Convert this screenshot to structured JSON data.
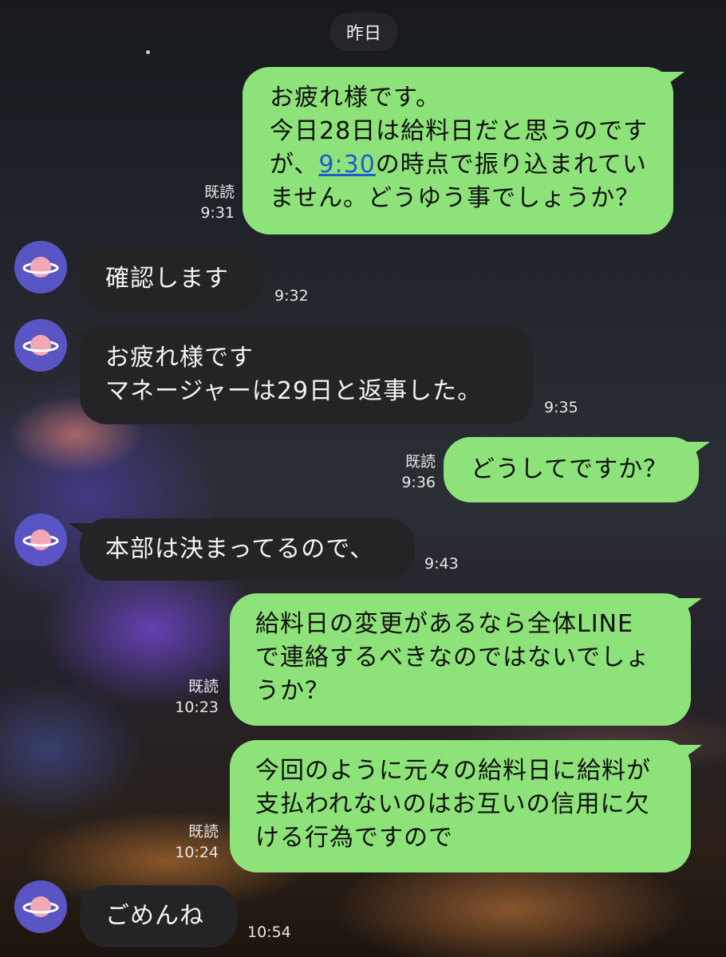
{
  "date_label": "昨日",
  "messages": [
    {
      "sender": "me",
      "lines": [
        "お疲れ様です。",
        "今日28日は給料日だと思うのです"
      ],
      "line3_prefix": "が、",
      "line3_link": "9:30",
      "line3_suffix": "の時点で振り込まれてい",
      "line4": "ません。どうゆう事でしょうか？",
      "read": "既読",
      "time": "9:31"
    },
    {
      "sender": "other",
      "text": "確認します",
      "time": "9:32"
    },
    {
      "sender": "other",
      "text": "お疲れ様です\nマネージャーは29日と返事した。",
      "time": "9:35"
    },
    {
      "sender": "me",
      "text": "どうしてですか？",
      "read": "既読",
      "time": "9:36"
    },
    {
      "sender": "other",
      "text": "本部は決まってるので、",
      "time": "9:43"
    },
    {
      "sender": "me",
      "text": "給料日の変更があるなら全体LINE\nで連絡するべきなのではないでしょ\nうか？",
      "read": "既読",
      "time": "10:23"
    },
    {
      "sender": "me",
      "text": "今回のように元々の給料日に給料が\n支払われないのはお互いの信用に欠\nける行為ですので",
      "read": "既読",
      "time": "10:24"
    },
    {
      "sender": "other",
      "text": "ごめんね",
      "time": "10:54"
    }
  ],
  "colors": {
    "outgoing": "#8ee27a",
    "incoming": "#242426",
    "avatar": "#5a55c4",
    "planet": "#f2a7b4"
  },
  "icons": {
    "avatar": "planet-icon"
  }
}
